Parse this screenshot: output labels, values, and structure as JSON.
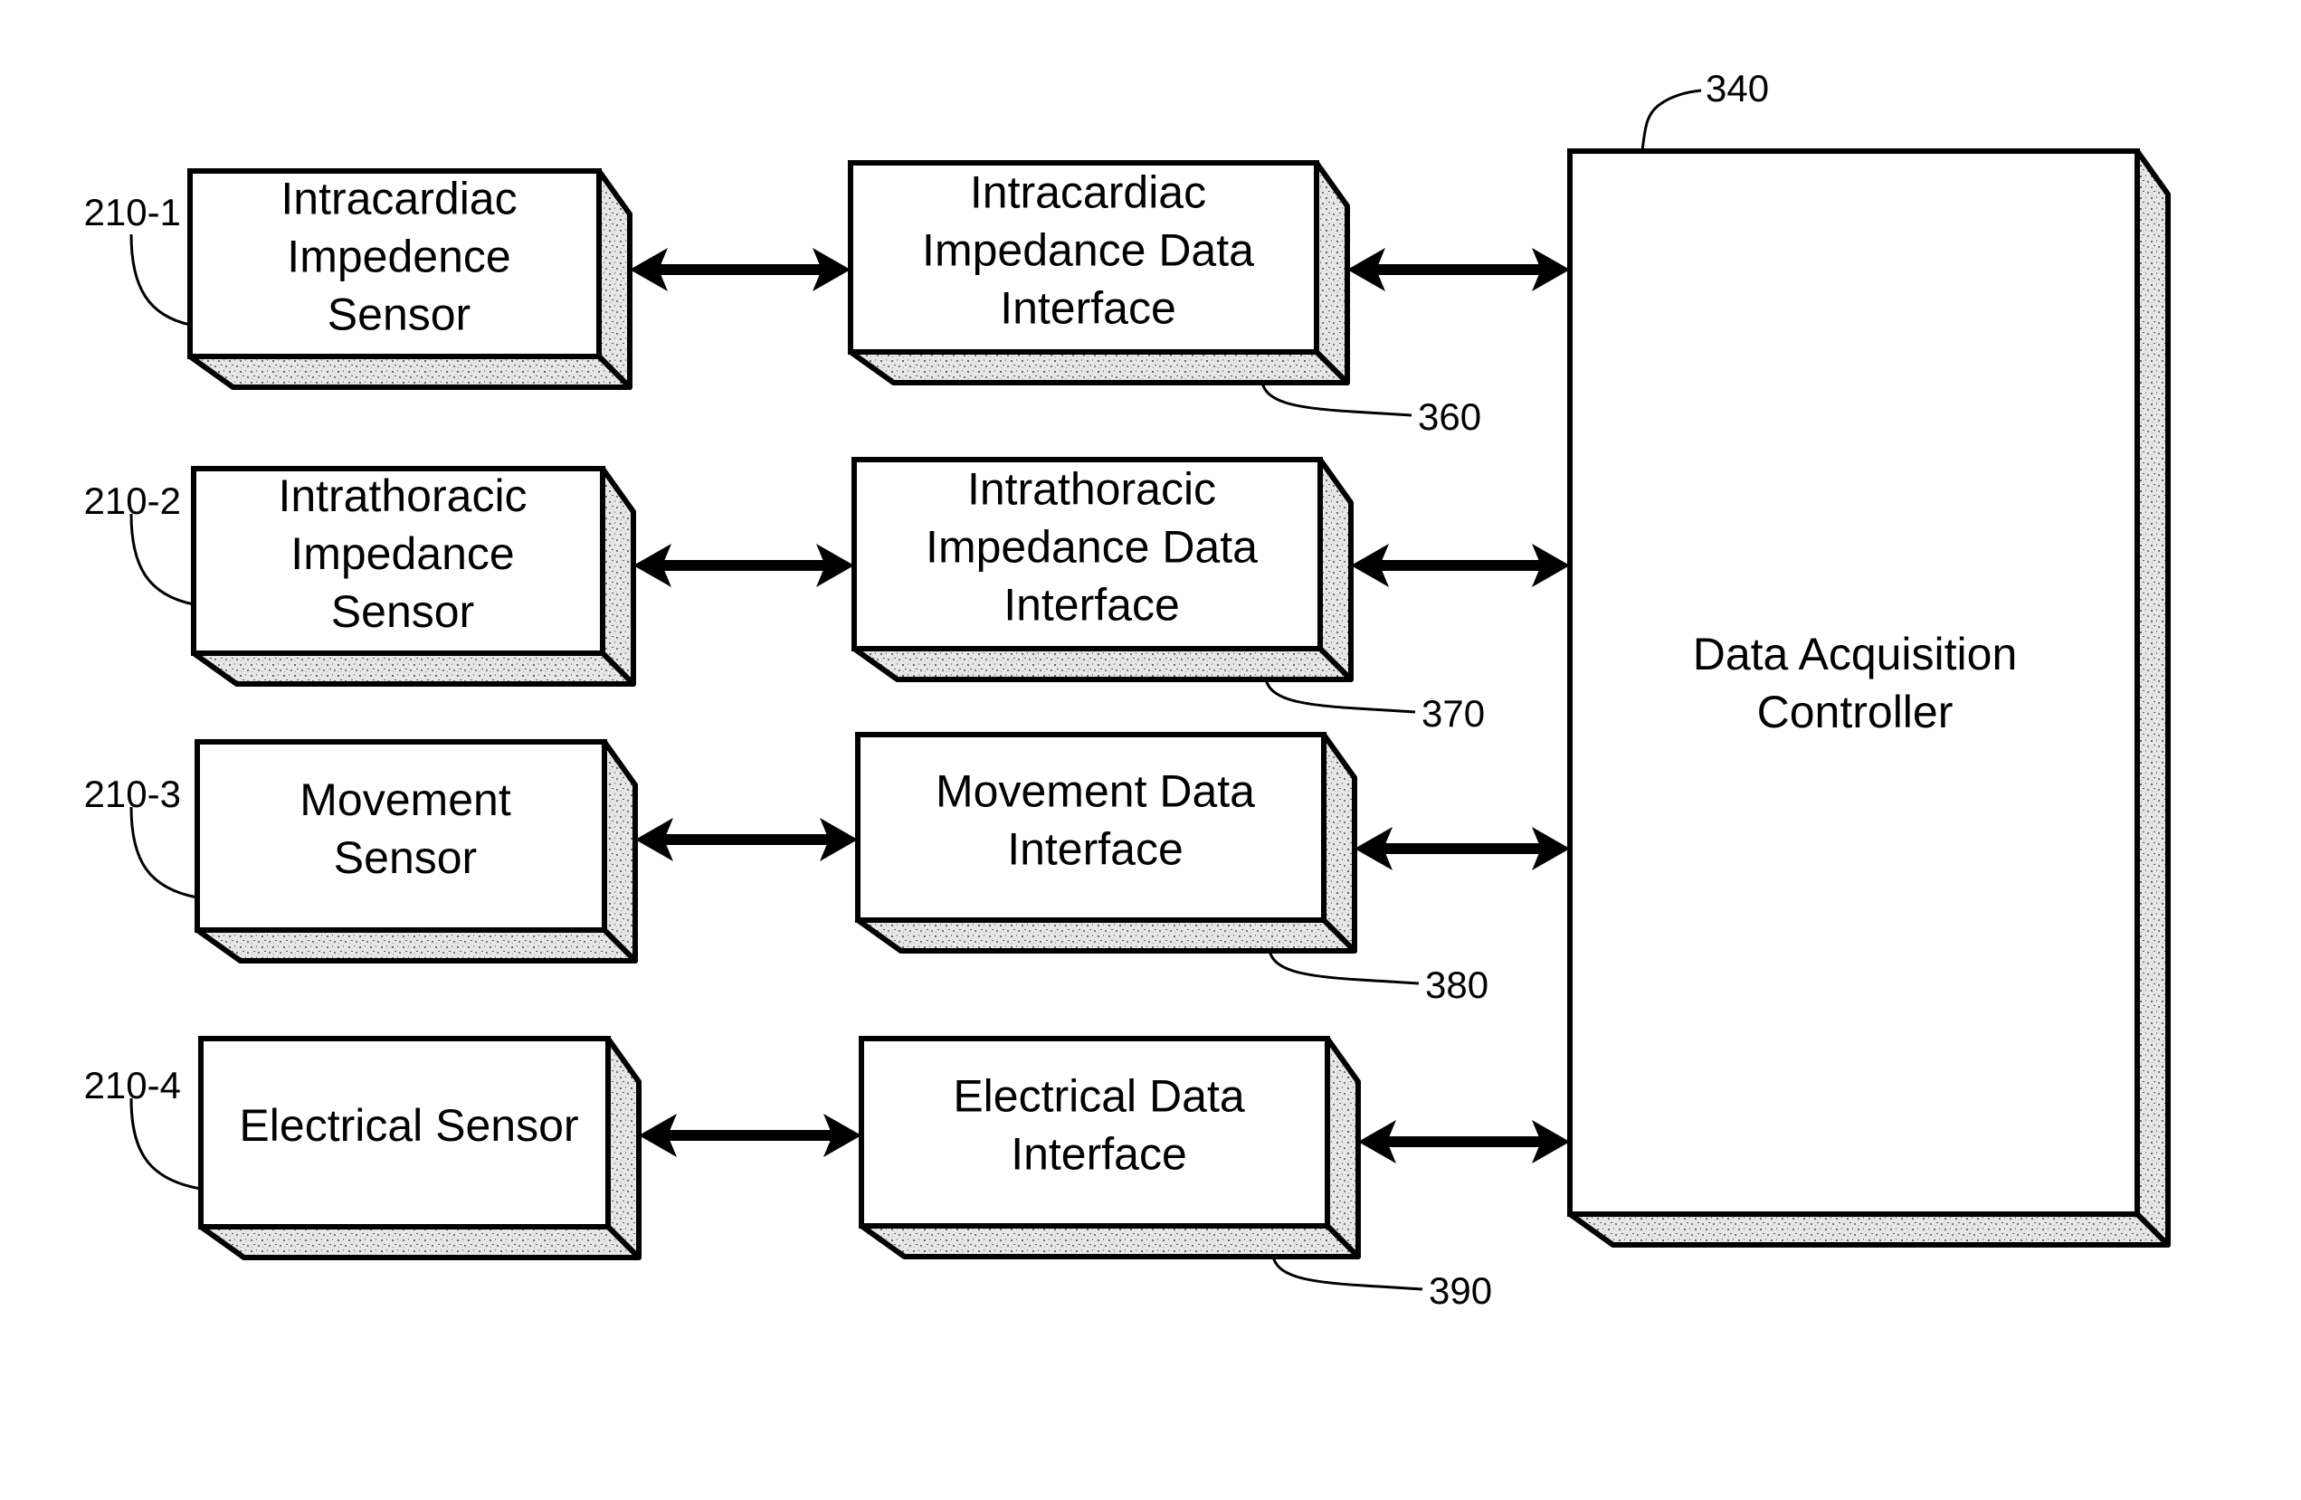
{
  "diagram": {
    "sensors": [
      {
        "ref": "210-1",
        "lines": [
          "Intracardiac",
          "Impedence",
          "Sensor"
        ]
      },
      {
        "ref": "210-2",
        "lines": [
          "Intrathoracic",
          "Impedance",
          "Sensor"
        ]
      },
      {
        "ref": "210-3",
        "lines": [
          "Movement",
          "Sensor"
        ]
      },
      {
        "ref": "210-4",
        "lines": [
          "Electrical Sensor"
        ]
      }
    ],
    "interfaces": [
      {
        "ref": "360",
        "lines": [
          "Intracardiac",
          "Impedance Data",
          "Interface"
        ]
      },
      {
        "ref": "370",
        "lines": [
          "Intrathoracic",
          "Impedance Data",
          "Interface"
        ]
      },
      {
        "ref": "380",
        "lines": [
          "Movement Data",
          "Interface"
        ]
      },
      {
        "ref": "390",
        "lines": [
          "Electrical Data",
          "Interface"
        ]
      }
    ],
    "controller": {
      "ref": "340",
      "lines": [
        "Data Acquisition",
        "Controller"
      ]
    },
    "connections": [
      {
        "from": "210-1",
        "to": "360",
        "direction": "bidirectional"
      },
      {
        "from": "210-2",
        "to": "370",
        "direction": "bidirectional"
      },
      {
        "from": "210-3",
        "to": "380",
        "direction": "bidirectional"
      },
      {
        "from": "210-4",
        "to": "390",
        "direction": "bidirectional"
      },
      {
        "from": "360",
        "to": "340",
        "direction": "bidirectional"
      },
      {
        "from": "370",
        "to": "340",
        "direction": "bidirectional"
      },
      {
        "from": "380",
        "to": "340",
        "direction": "bidirectional"
      },
      {
        "from": "390",
        "to": "340",
        "direction": "bidirectional"
      }
    ]
  }
}
